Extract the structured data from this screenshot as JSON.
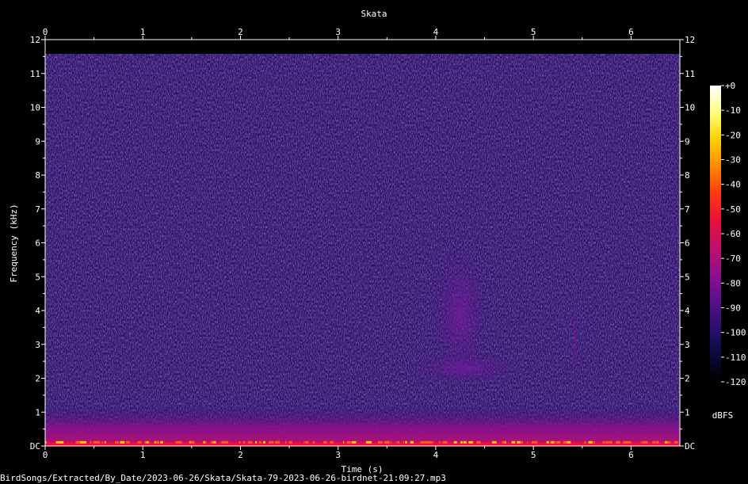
{
  "chart_data": {
    "type": "heatmap",
    "title": "Skata",
    "xlabel": "Time (s)",
    "ylabel": "Frequency (kHz)",
    "x_ticks": [
      "0",
      "1",
      "2",
      "3",
      "4",
      "5",
      "6"
    ],
    "x_range": [
      0,
      6.5
    ],
    "y_ticks": [
      "DC",
      "1",
      "2",
      "3",
      "4",
      "5",
      "6",
      "7",
      "8",
      "9",
      "10",
      "11",
      "12"
    ],
    "y_range": [
      0,
      12
    ],
    "colorbar": {
      "label": "dBFS",
      "ticks": [
        "+0",
        "-10",
        "-20",
        "-30",
        "-40",
        "-50",
        "-60",
        "-70",
        "-80",
        "-90",
        "-100",
        "-110",
        "-120"
      ],
      "range": [
        -120,
        0
      ],
      "colormap": [
        "#000000",
        "#0a0a3a",
        "#2a0f6e",
        "#5a0f8c",
        "#8e0f8e",
        "#c0106a",
        "#e8103a",
        "#ff3a10",
        "#ff8a00",
        "#ffd000",
        "#ffff80",
        "#ffffff"
      ]
    },
    "background_level_dbfs": -105,
    "low_frequency_band": {
      "freq_khz": [
        0,
        1.2
      ],
      "level_dbfs": -80
    },
    "dc_band": {
      "freq_khz": [
        0,
        0.12
      ],
      "level_dbfs": -45
    },
    "sound_events": [
      {
        "time_s": [
          3.95,
          4.55
        ],
        "freq_khz": [
          1.8,
          6.0
        ],
        "level_dbfs": -90
      },
      {
        "time_s": [
          3.7,
          4.9
        ],
        "freq_khz": [
          1.8,
          2.8
        ],
        "level_dbfs": -88
      },
      {
        "time_s": [
          5.4,
          5.45
        ],
        "freq_khz": [
          1.8,
          4.5
        ],
        "level_dbfs": -93
      }
    ]
  },
  "footer": {
    "filename": "BirdSongs/Extracted/By_Date/2023-06-26/Skata/Skata-79-2023-06-26-birdnet-21:09:27.mp3"
  }
}
